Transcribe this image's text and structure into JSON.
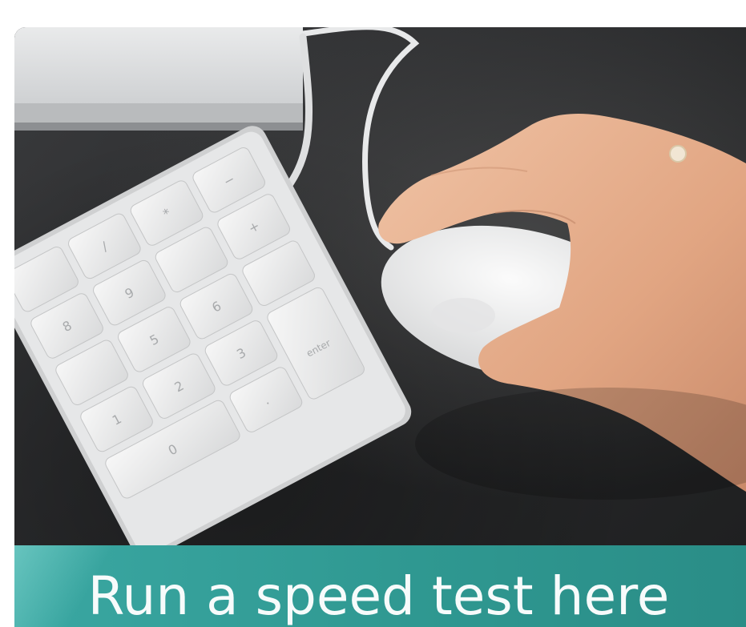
{
  "banner": {
    "cta_label": "Run a speed test here"
  },
  "keypad": {
    "keys": [
      "/",
      "*",
      "−",
      "9",
      "8",
      "+",
      "6",
      "5",
      "3",
      "2",
      "1",
      "0",
      ".",
      "enter"
    ]
  },
  "colors": {
    "cta_background": "#2f9891",
    "cta_text": "#f7fbfb",
    "desk": "#2b2b2b"
  }
}
